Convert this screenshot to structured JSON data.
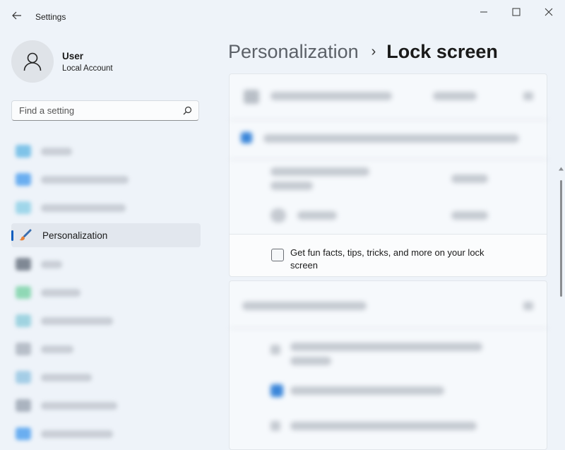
{
  "window": {
    "app_title": "Settings",
    "back_icon": "back-arrow-icon",
    "controls": [
      "minimize-icon",
      "maximize-icon",
      "close-icon"
    ]
  },
  "profile": {
    "name": "User",
    "account_type": "Local Account",
    "avatar_icon": "user-icon"
  },
  "search": {
    "placeholder": "Find a setting",
    "icon": "search-icon"
  },
  "sidebar": {
    "active_item": {
      "label": "Personalization",
      "icon": "paintbrush-icon"
    }
  },
  "breadcrumb": {
    "parent": "Personalization",
    "separator": "›",
    "current": "Lock screen"
  },
  "lock_screen": {
    "fun_facts_checkbox": {
      "label": "Get fun facts, tips, tricks, and more on your lock screen",
      "checked": false
    }
  },
  "colors": {
    "accent": "#0a5dbf",
    "background": "#eef3f9",
    "card": "#fbfcfd"
  }
}
